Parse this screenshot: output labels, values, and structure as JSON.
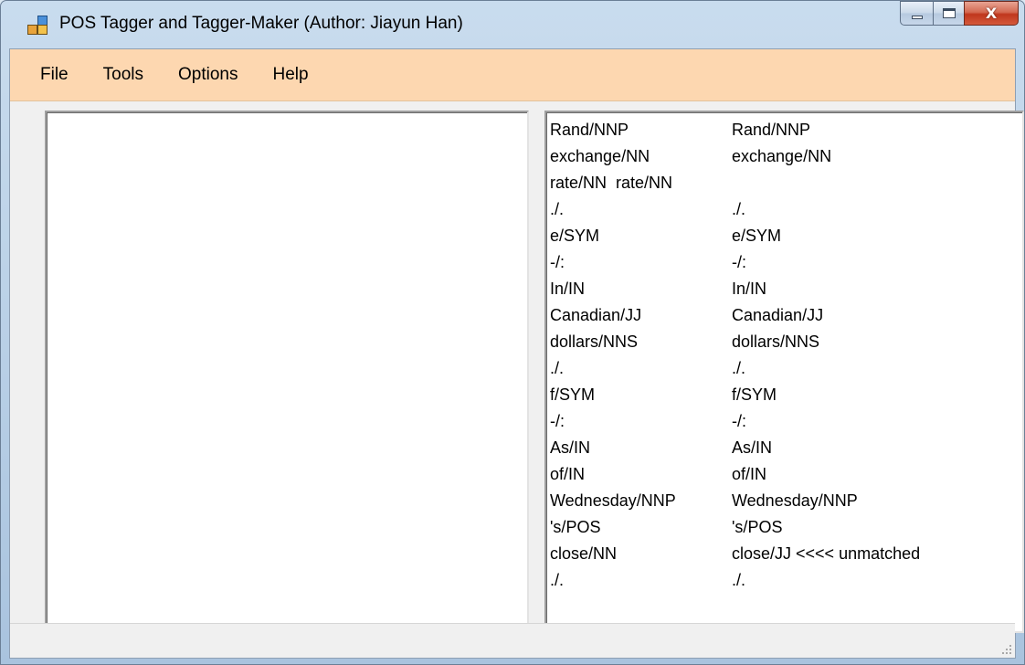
{
  "window": {
    "title": "POS Tagger and Tagger-Maker (Author: Jiayun Han)",
    "close_glyph": "X"
  },
  "menu": [
    "File",
    "Tools",
    "Options",
    "Help"
  ],
  "left_pane": {
    "value": ""
  },
  "right_pane": {
    "lines": [
      [
        "Rand/NNP",
        "Rand/NNP"
      ],
      [
        "exchange/NN",
        "exchange/NN"
      ],
      [
        "rate/NN  rate/NN",
        ""
      ],
      [
        "./.",
        "./."
      ],
      [
        "e/SYM",
        "e/SYM"
      ],
      [
        "-/:",
        "-/:"
      ],
      [
        "In/IN",
        "In/IN"
      ],
      [
        "Canadian/JJ",
        "Canadian/JJ"
      ],
      [
        "dollars/NNS",
        "dollars/NNS"
      ],
      [
        "./.",
        "./."
      ],
      [
        "f/SYM",
        "f/SYM"
      ],
      [
        "-/:",
        "-/:"
      ],
      [
        "As/IN",
        "As/IN"
      ],
      [
        "of/IN",
        "of/IN"
      ],
      [
        "Wednesday/NNP",
        "Wednesday/NNP"
      ],
      [
        "'s/POS",
        "'s/POS"
      ],
      [
        "close/NN",
        "close/JJ <<<< unmatched"
      ],
      [
        "./.",
        "./."
      ]
    ]
  },
  "icons": {
    "app": "app-window-icon",
    "minimize": "minimize-icon",
    "maximize": "maximize-icon",
    "close": "close-icon",
    "grip": "resize-grip-icon"
  },
  "colors": {
    "menubar_bg": "#fdd7b0",
    "client_bg": "#f0f0f0",
    "close_button": "#c0371d"
  }
}
